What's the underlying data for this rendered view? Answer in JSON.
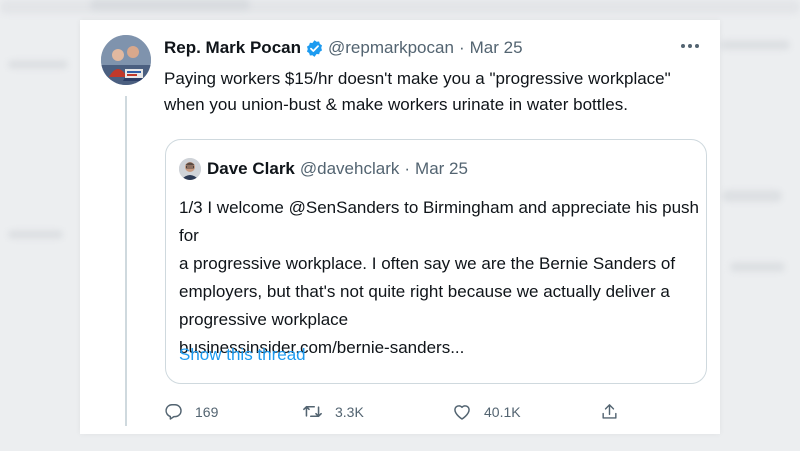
{
  "tweet": {
    "author_name": "Rep. Mark Pocan",
    "author_handle": "@repmarkpocan",
    "separator": "·",
    "date": "Mar 25",
    "text": "Paying workers $15/hr doesn't make you a \"progressive workplace\" when you union-bust & make workers urinate in water bottles.",
    "verified": true
  },
  "quote": {
    "author_name": "Dave Clark",
    "author_handle": "@davehclark",
    "separator": "·",
    "date": "Mar 25",
    "lines": [
      "1/3 I welcome @SenSanders to Birmingham and appreciate his push for",
      "a progressive workplace. I often say we are the Bernie Sanders of",
      "employers, but that's not quite right because we actually deliver a",
      "progressive workplace",
      "businessinsider.com/bernie-sanders..."
    ],
    "show_thread_label": "Show this thread"
  },
  "actions": {
    "reply_count": "169",
    "retweet_count": "3.3K",
    "like_count": "40.1K"
  },
  "icons": {
    "verified": "verified-badge-icon",
    "more": "more-options-icon",
    "reply": "reply-icon",
    "retweet": "retweet-icon",
    "like": "heart-icon",
    "share": "share-icon"
  },
  "colors": {
    "accent": "#1d9bf0",
    "text": "#0f1419",
    "muted": "#536471",
    "border": "#cfd9de"
  }
}
